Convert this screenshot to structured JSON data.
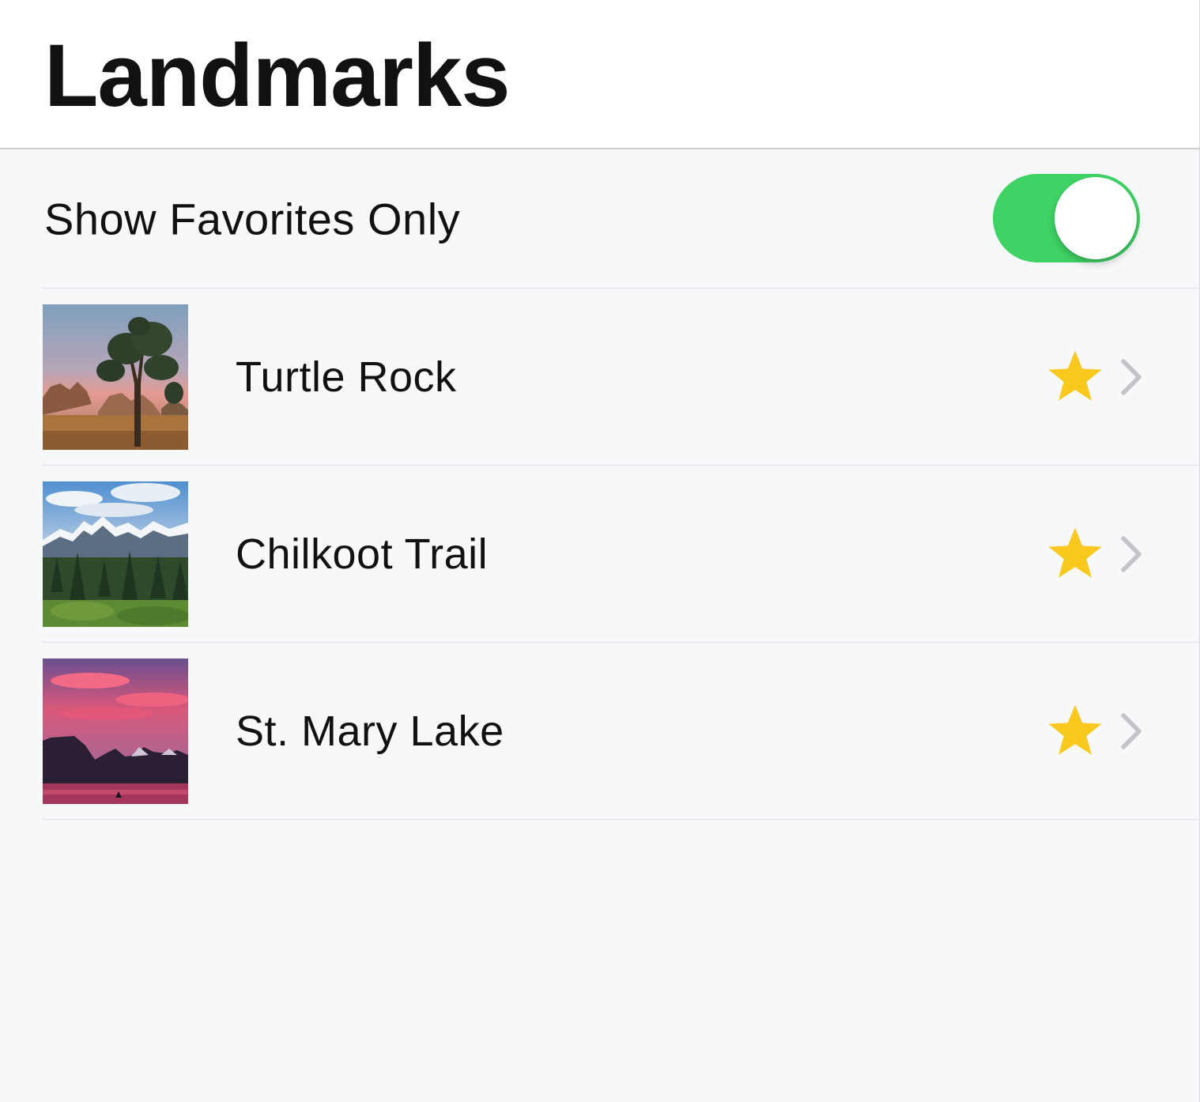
{
  "header": {
    "title": "Landmarks"
  },
  "filter": {
    "label": "Show Favorites Only",
    "enabled": true
  },
  "landmarks": [
    {
      "name": "Turtle Rock",
      "favorite": true,
      "image": "desert-joshua-tree"
    },
    {
      "name": "Chilkoot Trail",
      "favorite": true,
      "image": "snowy-mountain-forest"
    },
    {
      "name": "St. Mary Lake",
      "favorite": true,
      "image": "pink-sunset-lake"
    }
  ],
  "colors": {
    "toggle_on": "#3fd265",
    "star": "#f8c81c",
    "chevron": "#c4c4c8",
    "separator": "#dcdde0"
  }
}
